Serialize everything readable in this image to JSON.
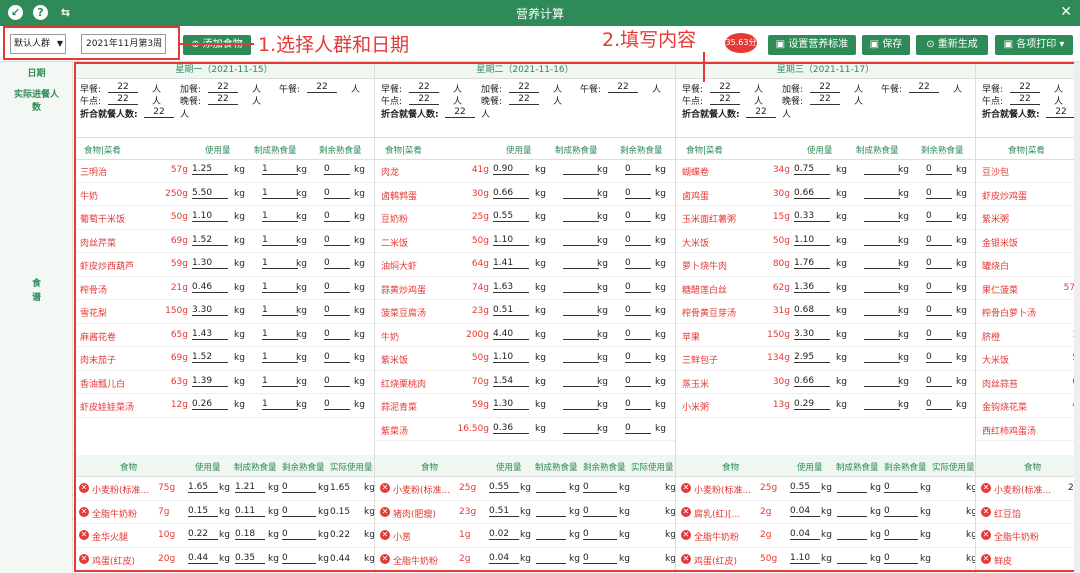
{
  "app": {
    "title": "营养计算",
    "close": "✕"
  },
  "toolbar": {
    "crowd": "默认人群",
    "date": "2021年11月第3周",
    "add_food": "添加食物",
    "score": "35.63分",
    "set_standard": "设置营养标准",
    "save": "保存",
    "regenerate": "重新生成",
    "print": "各项打印"
  },
  "annotations": {
    "step1": "1.选择人群和日期",
    "step2": "2.填写内容"
  },
  "left": {
    "date": "日期",
    "diners": "实际进餐人数",
    "menu": "食谱"
  },
  "labels": {
    "breakfast": "早餐:",
    "extra_meal": "加餐:",
    "lunch": "午餐:",
    "snack": "午点:",
    "dinner": "晚餐:",
    "total": "折合就餐人数:",
    "person": "人",
    "kg": "kg",
    "food_dish": "食物|菜肴",
    "usage": "使用量",
    "cooked": "制成熟食量",
    "remaining": "剩余熟食量",
    "food": "食物",
    "actual": "实际使用量"
  },
  "days": [
    {
      "header": "星期一（2021-11-15）",
      "persons": {
        "breakfast": "22",
        "extra": "22",
        "lunch": "22",
        "snack": "22",
        "dinner": "22",
        "total": "22"
      },
      "foods": [
        [
          "三明治",
          "57g",
          "1.25",
          "1",
          "0"
        ],
        [
          "牛奶",
          "250g",
          "5.50",
          "1",
          "0"
        ],
        [
          "葡萄干米饭",
          "50g",
          "1.10",
          "1",
          "0"
        ],
        [
          "肉丝芹菜",
          "69g",
          "1.52",
          "1",
          "0"
        ],
        [
          "虾皮炒西葫芦",
          "59g",
          "1.30",
          "1",
          "0"
        ],
        [
          "榨骨汤",
          "21g",
          "0.46",
          "1",
          "0"
        ],
        [
          "雪花梨",
          "150g",
          "3.30",
          "1",
          "0"
        ],
        [
          "麻酱花卷",
          "65g",
          "1.43",
          "1",
          "0"
        ],
        [
          "肉末茄子",
          "69g",
          "1.52",
          "1",
          "0"
        ],
        [
          "香油瓢儿白",
          "63g",
          "1.39",
          "1",
          "0"
        ],
        [
          "虾皮娃娃菜汤",
          "12g",
          "0.26",
          "1",
          "0"
        ]
      ],
      "ingredients": [
        [
          "小麦粉(标准...",
          "75g",
          "1.65",
          "1.21",
          "0",
          "1.65"
        ],
        [
          "全脂牛奶粉",
          "7g",
          "0.15",
          "0.11",
          "0",
          "0.15"
        ],
        [
          "金华火腿",
          "10g",
          "0.22",
          "0.18",
          "0",
          "0.22"
        ],
        [
          "鸡蛋(红皮)",
          "20g",
          "0.44",
          "0.35",
          "0",
          "0.44"
        ]
      ]
    },
    {
      "header": "星期二（2021-11-16）",
      "persons": {
        "breakfast": "22",
        "extra": "22",
        "lunch": "22",
        "snack": "22",
        "dinner": "22",
        "total": "22"
      },
      "foods": [
        [
          "肉龙",
          "41g",
          "0.90",
          "",
          "0"
        ],
        [
          "卤鹌鹑蛋",
          "30g",
          "0.66",
          "",
          "0"
        ],
        [
          "豆奶粉",
          "25g",
          "0.55",
          "",
          "0"
        ],
        [
          "二米饭",
          "50g",
          "1.10",
          "",
          "0"
        ],
        [
          "油焖大虾",
          "64g",
          "1.41",
          "",
          "0"
        ],
        [
          "蒜黄炒鸡蛋",
          "74g",
          "1.63",
          "",
          "0"
        ],
        [
          "菠菜豆腐汤",
          "23g",
          "0.51",
          "",
          "0"
        ],
        [
          "牛奶",
          "200g",
          "4.40",
          "",
          "0"
        ],
        [
          "紫米饭",
          "50g",
          "1.10",
          "",
          "0"
        ],
        [
          "红烧栗桃肉",
          "70g",
          "1.54",
          "",
          "0"
        ],
        [
          "蒜泥青菜",
          "59g",
          "1.30",
          "",
          "0"
        ],
        [
          "紫菜汤",
          "16.50g",
          "0.36",
          "",
          "0"
        ]
      ],
      "ingredients": [
        [
          "小麦粉(标准...",
          "25g",
          "0.55",
          "",
          "0",
          ""
        ],
        [
          "猪肉(肥瘦)",
          "23g",
          "0.51",
          "",
          "0",
          ""
        ],
        [
          "小葱",
          "1g",
          "0.02",
          "",
          "0",
          ""
        ],
        [
          "全脂牛奶粉",
          "2g",
          "0.04",
          "",
          "0",
          ""
        ]
      ]
    },
    {
      "header": "星期三（2021-11-17）",
      "persons": {
        "breakfast": "22",
        "extra": "22",
        "lunch": "22",
        "snack": "22",
        "dinner": "22",
        "total": "22"
      },
      "foods": [
        [
          "蝴蝶卷",
          "34g",
          "0.75",
          "",
          "0"
        ],
        [
          "卤鸡蛋",
          "30g",
          "0.66",
          "",
          "0"
        ],
        [
          "玉米面红薯粥",
          "15g",
          "0.33",
          "",
          "0"
        ],
        [
          "大米饭",
          "50g",
          "1.10",
          "",
          "0"
        ],
        [
          "萝卜烧牛肉",
          "80g",
          "1.76",
          "",
          "0"
        ],
        [
          "糖醋莲白丝",
          "62g",
          "1.36",
          "",
          "0"
        ],
        [
          "榨骨黄豆芽汤",
          "31g",
          "0.68",
          "",
          "0"
        ],
        [
          "苹果",
          "150g",
          "3.30",
          "",
          "0"
        ],
        [
          "三鲜包子",
          "134g",
          "2.95",
          "",
          "0"
        ],
        [
          "蒸玉米",
          "30g",
          "0.66",
          "",
          "0"
        ],
        [
          "小米粥",
          "13g",
          "0.29",
          "",
          "0"
        ]
      ],
      "ingredients": [
        [
          "小麦粉(标准...",
          "25g",
          "0.55",
          "",
          "0",
          ""
        ],
        [
          "腐乳(红)[...",
          "2g",
          "0.04",
          "",
          "0",
          ""
        ],
        [
          "全脂牛奶粉",
          "2g",
          "0.04",
          "",
          "0",
          ""
        ],
        [
          "鸡蛋(红皮)",
          "50g",
          "1.10",
          "",
          "0",
          ""
        ]
      ]
    },
    {
      "header": "",
      "persons": {
        "breakfast": "22",
        "extra": "",
        "lunch": "",
        "snack": "22",
        "dinner": "",
        "total": "22"
      },
      "foods": [
        [
          "豆沙包",
          ""
        ],
        [
          "虾皮炒鸡蛋",
          ""
        ],
        [
          "紫米粥",
          ""
        ],
        [
          "金银米饭",
          ""
        ],
        [
          "罐烧白",
          ""
        ],
        [
          "果仁菠菜",
          "57."
        ],
        [
          "榨骨白萝卜汤",
          ""
        ],
        [
          "脐橙",
          "1"
        ],
        [
          "大米饭",
          "5"
        ],
        [
          "肉丝蒜苔",
          "6"
        ],
        [
          "金钩烧花菜",
          "4"
        ],
        [
          "西红柿鸡蛋汤",
          ""
        ]
      ],
      "ingredients": [
        [
          "小麦粉(标准...",
          "2"
        ],
        [
          "红豆馅",
          ""
        ],
        [
          "全脂牛奶粉",
          ""
        ],
        [
          "鲜皮",
          ""
        ]
      ]
    }
  ]
}
